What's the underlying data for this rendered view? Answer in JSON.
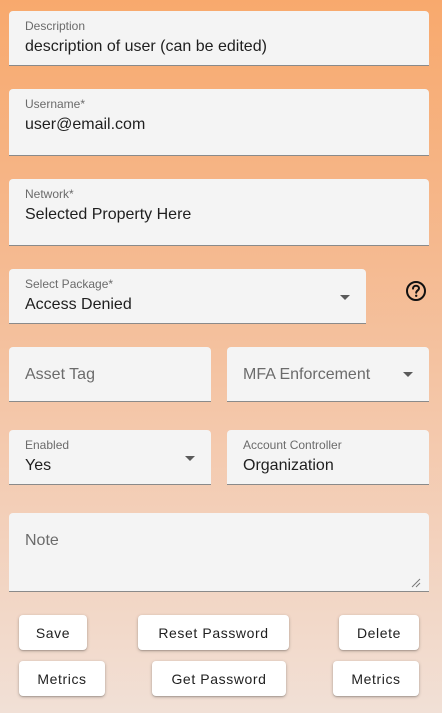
{
  "fields": {
    "description": {
      "label": "Description",
      "value": "description of user (can be edited)"
    },
    "username": {
      "label": "Username*",
      "value": "user@email.com"
    },
    "network": {
      "label": "Network*",
      "value": "Selected Property Here"
    },
    "package": {
      "label": "Select Package*",
      "value": "Access Denied",
      "help_icon": "help-circle-icon"
    },
    "asset_tag": {
      "placeholder": "Asset Tag"
    },
    "mfa": {
      "placeholder": "MFA Enforcement"
    },
    "enabled": {
      "label": "Enabled",
      "value": "Yes"
    },
    "account_controller": {
      "label": "Account Controller",
      "value": "Organization"
    },
    "note": {
      "placeholder": "Note"
    }
  },
  "buttons": {
    "row1": [
      "Save",
      "Reset Password",
      "Delete"
    ],
    "row2": [
      "Metrics",
      "Get Password",
      "Metrics"
    ]
  }
}
